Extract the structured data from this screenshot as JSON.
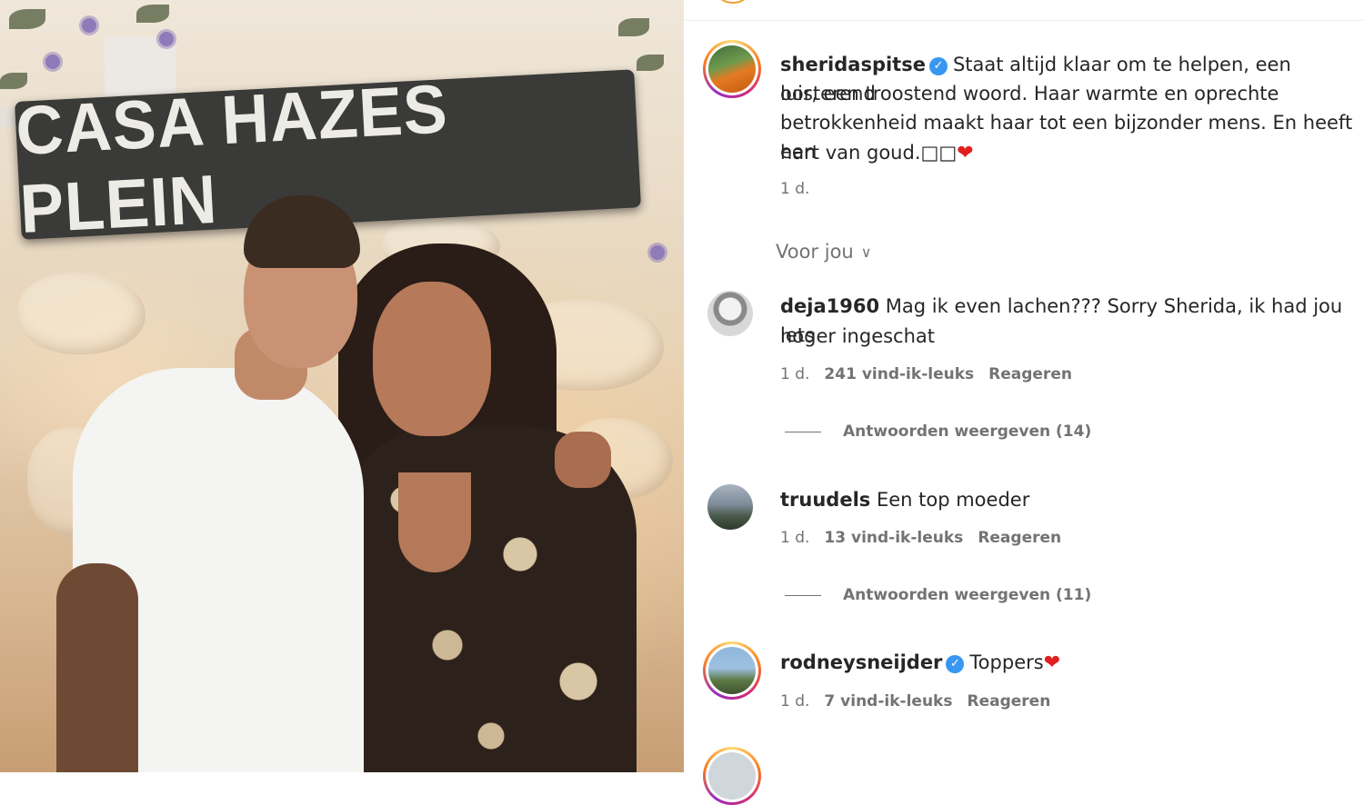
{
  "photo": {
    "sign_text": "CASA HAZES PLEIN"
  },
  "caption": {
    "username": "sheridaspitse",
    "verified": true,
    "lines": [
      "Staat altijd klaar om te helpen, een luisterend",
      "oor, een troostend woord. Haar warmte en oprechte",
      "betrokkenheid maakt haar tot een bijzonder mens. En heeft een",
      "hart van goud.□□"
    ],
    "heart": "❤",
    "time": "1 d."
  },
  "filter": {
    "label": "Voor jou",
    "chevron": "⌵"
  },
  "comments": [
    {
      "username": "deja1960",
      "verified": false,
      "lines": [
        "Mag ik even lachen??? Sorry Sherida, ik had jou iets",
        "hoger ingeschat"
      ],
      "time": "1 d.",
      "likes": "241 vind-ik-leuks",
      "reply_label": "Reageren",
      "view_replies": "Antwoorden weergeven (14)"
    },
    {
      "username": "truudels",
      "verified": false,
      "lines": [
        "Een top moeder"
      ],
      "time": "1 d.",
      "likes": "13 vind-ik-leuks",
      "reply_label": "Reageren",
      "view_replies": "Antwoorden weergeven (11)"
    },
    {
      "username": "rodneysneijder",
      "verified": true,
      "lines": [
        "Toppers"
      ],
      "heart": "❤",
      "time": "1 d.",
      "likes": "7 vind-ik-leuks",
      "reply_label": "Reageren"
    }
  ],
  "icons": {
    "verified": "verified-badge-icon",
    "heart": "heart-emoji",
    "chevron": "chevron-down-icon"
  },
  "colors": {
    "verified": "#3897f0",
    "muted": "#737373",
    "text": "#262626",
    "heart": "#e0201e"
  }
}
